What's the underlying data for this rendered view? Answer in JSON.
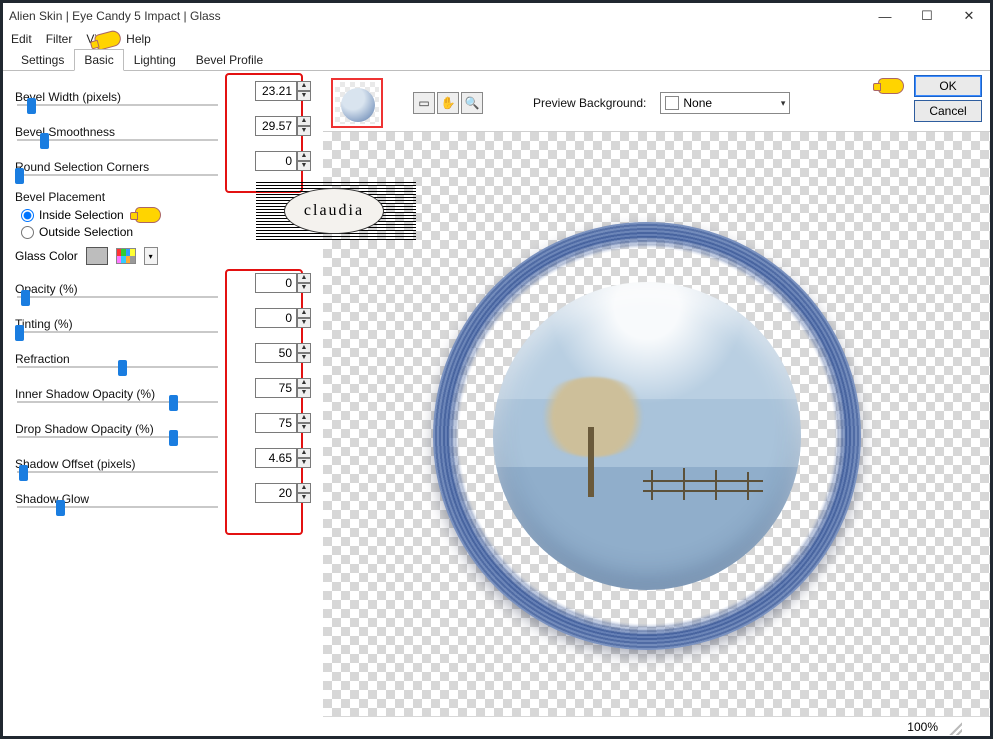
{
  "window": {
    "title": "Alien Skin | Eye Candy 5 Impact | Glass"
  },
  "menu": {
    "edit": "Edit",
    "filter": "Filter",
    "view": "View",
    "help": "Help"
  },
  "tabs": {
    "settings": "Settings",
    "basic": "Basic",
    "lighting": "Lighting",
    "bevel_profile": "Bevel Profile"
  },
  "panel": {
    "bevel_width": {
      "label": "Bevel Width (pixels)",
      "value": "23.21",
      "thumb_pct": 6
    },
    "bevel_smooth": {
      "label": "Bevel Smoothness",
      "value": "29.57",
      "thumb_pct": 12
    },
    "round_corners": {
      "label": "Round Selection Corners",
      "value": "0",
      "thumb_pct": 0
    },
    "placement": {
      "label": "Bevel Placement",
      "inside": "Inside Selection",
      "outside": "Outside Selection"
    },
    "glass_color": {
      "label": "Glass Color"
    },
    "opacity": {
      "label": "Opacity (%)",
      "value": "0",
      "thumb_pct": 3
    },
    "tinting": {
      "label": "Tinting (%)",
      "value": "0",
      "thumb_pct": 0
    },
    "refraction": {
      "label": "Refraction",
      "value": "50",
      "thumb_pct": 50
    },
    "inner_shadow": {
      "label": "Inner Shadow Opacity (%)",
      "value": "75",
      "thumb_pct": 75
    },
    "drop_shadow": {
      "label": "Drop Shadow Opacity (%)",
      "value": "75",
      "thumb_pct": 75
    },
    "shadow_offset": {
      "label": "Shadow Offset (pixels)",
      "value": "4.65",
      "thumb_pct": 2
    },
    "shadow_glow": {
      "label": "Shadow Glow",
      "value": "20",
      "thumb_pct": 20
    }
  },
  "right": {
    "preview_bg_label": "Preview Background:",
    "preview_bg_value": "None",
    "ok": "OK",
    "cancel": "Cancel"
  },
  "status": {
    "zoom": "100%"
  },
  "watermark": "claudia"
}
